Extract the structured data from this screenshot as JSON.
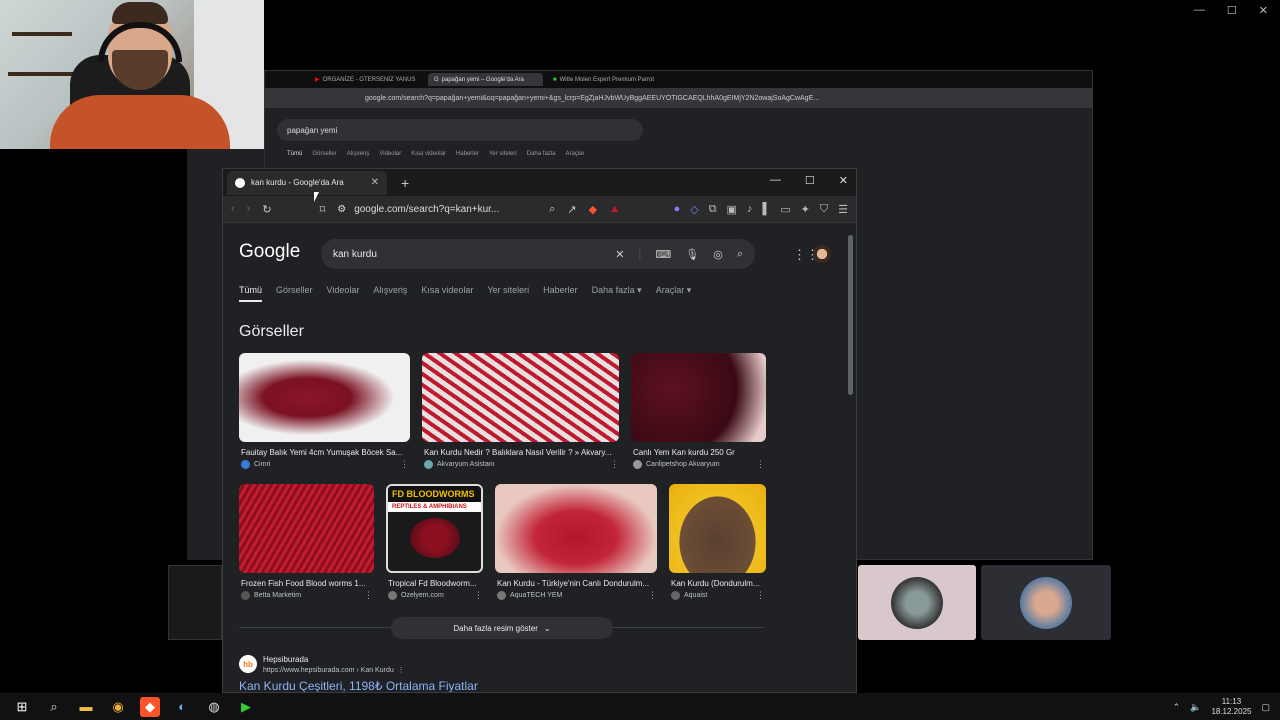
{
  "os": {
    "minimize": "—",
    "maximize": "☐",
    "close": "✕"
  },
  "back_browser": {
    "tabs": [
      {
        "label": "ORGANİZE - GTERSENİZ YANUS",
        "icon": "youtube-icon"
      },
      {
        "label": "papağan yemi – Google'da Ara",
        "icon": "google-icon"
      },
      {
        "label": "Witte Molen Expert Premium Parrot",
        "icon": "site-icon"
      }
    ],
    "url": "google.com/search?q=papağan+yemi&oq=papağan+yemi+&gs_lcrp=EgZjaHJvbWUyBggAEEUYOTIGCAEQLhhA0gEIMjY2N2owajSoAgCwAgE...",
    "search_value": "papağan yemi",
    "nav": [
      "Tümü",
      "Görseller",
      "Alışveriş",
      "Videolar",
      "Kısa videolar",
      "Haberler",
      "Yer siteleri",
      "Daha fazla",
      "Araçlar"
    ]
  },
  "front_browser": {
    "tab_title": "kan kurdu - Google'da Ara",
    "url": "google.com/search?q=kan+kur...",
    "logo": "Google",
    "search_value": "kan kurdu",
    "nav": {
      "all": "Tümü",
      "images": "Görseller",
      "videos": "Videolar",
      "shopping": "Alışveriş",
      "short_videos": "Kısa videolar",
      "places": "Yer siteleri",
      "news": "Haberler",
      "more": "Daha fazla",
      "tools": "Araçlar"
    },
    "section_title": "Görseller",
    "images": [
      {
        "caption": "Fauitay Balık Yemi 4cm Yumuşak Böcek Sa...",
        "source": "Cimri"
      },
      {
        "caption": "Kan Kurdu Nedir ? Balıklara Nasıl Verilir ? » Akvary...",
        "source": "Akvaryum Asistanı"
      },
      {
        "caption": "Canlı Yem Kan kurdu 250 Gr",
        "source": "Canlipetshop Akvaryum"
      },
      {
        "caption": "Frozen Fish Food Blood worms 1...",
        "source": "Betta Marketim"
      },
      {
        "caption": "Tropical Fd Bloodworm...",
        "source": "Ozelyem.com"
      },
      {
        "caption": "Kan Kurdu - Türkiye'nin Canlı Dondurulm...",
        "source": "AquaTECH YEM"
      },
      {
        "caption": "Kan Kurdu (Dondurulm...",
        "source": "Aquaist"
      }
    ],
    "bloodworms_label": "FD BLOODWORMS",
    "reptiles_label": "REPTILES & AMPHIBIANS",
    "show_more": "Daha fazla resim göster",
    "result": {
      "favicon": "hb",
      "site": "Hepsiburada",
      "url": "https://www.hepsiburada.com › Kan Kurdu",
      "title": "Kan Kurdu Çeşitleri, 1198₺ Ortalama Fiyatlar"
    }
  },
  "taskbar": {
    "time": "11:13",
    "date": "18.12.2025"
  }
}
